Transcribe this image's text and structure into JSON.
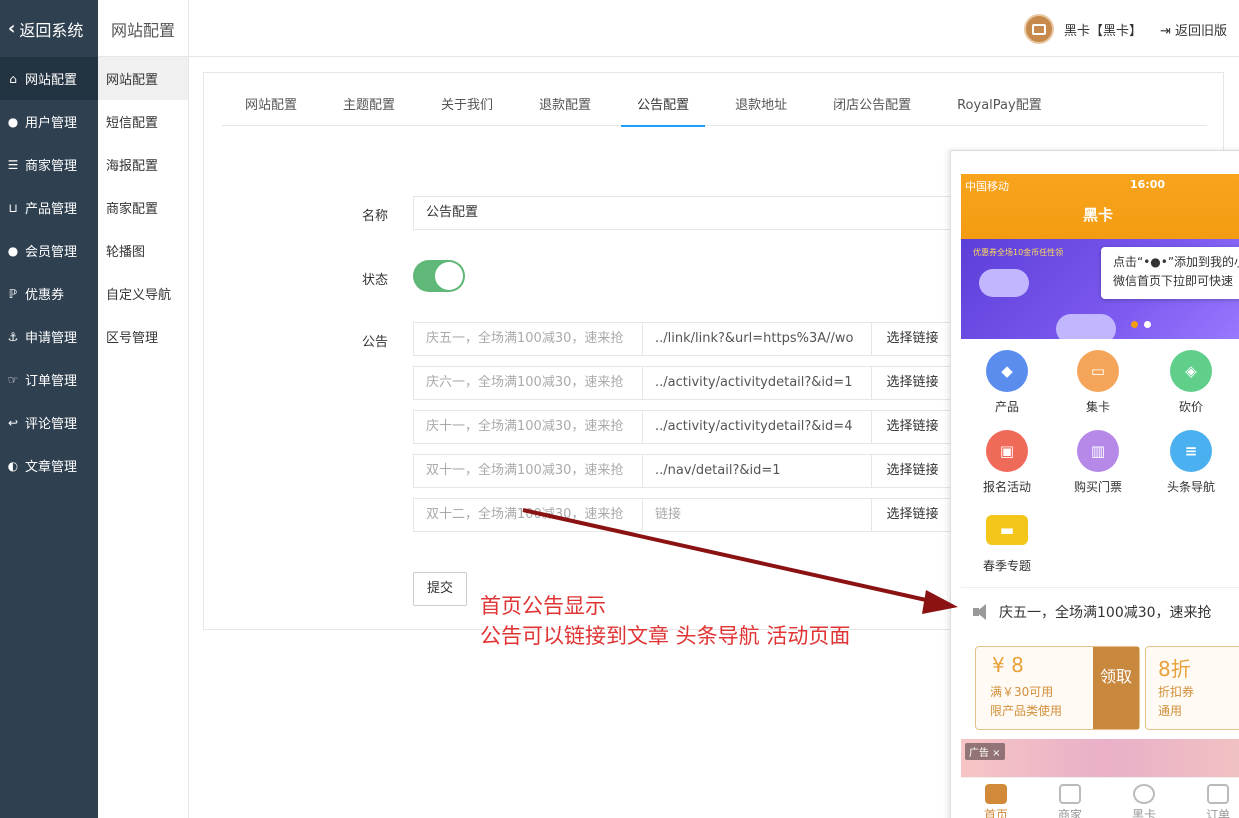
{
  "header": {
    "back_label": "返回系统",
    "section_title": "网站配置",
    "user_name": "黑卡【黑卡】",
    "old_version_label": "返回旧版"
  },
  "sidebar": {
    "items": [
      {
        "label": "网站配置",
        "icon": "home-icon"
      },
      {
        "label": "用户管理",
        "icon": "user-icon"
      },
      {
        "label": "商家管理",
        "icon": "server-icon"
      },
      {
        "label": "产品管理",
        "icon": "cart-icon"
      },
      {
        "label": "会员管理",
        "icon": "users-icon"
      },
      {
        "label": "优惠券",
        "icon": "ticket-icon"
      },
      {
        "label": "申请管理",
        "icon": "anchor-icon"
      },
      {
        "label": "订单管理",
        "icon": "hand-icon"
      },
      {
        "label": "评论管理",
        "icon": "reply-icon"
      },
      {
        "label": "文章管理",
        "icon": "contrast-icon"
      }
    ]
  },
  "subnav": {
    "items": [
      "网站配置",
      "短信配置",
      "海报配置",
      "商家配置",
      "轮播图",
      "自定义导航",
      "区号管理"
    ]
  },
  "tabs": [
    "网站配置",
    "主题配置",
    "关于我们",
    "退款配置",
    "公告配置",
    "退款地址",
    "闭店公告配置",
    "RoyalPay配置"
  ],
  "form": {
    "name_label": "名称",
    "name_value": "公告配置",
    "status_label": "状态",
    "status_on": true,
    "announce_label": "公告",
    "rows": [
      {
        "text": "庆五一，全场满100减30，速来抢",
        "link": "../link/link?&url=https%3A//wo",
        "link_is_placeholder": false
      },
      {
        "text": "庆六一，全场满100减30，速来抢",
        "link": "../activity/activitydetail?&id=1",
        "link_is_placeholder": false
      },
      {
        "text": "庆十一，全场满100减30，速来抢",
        "link": "../activity/activitydetail?&id=4",
        "link_is_placeholder": false
      },
      {
        "text": "双十一，全场满100减30，速来抢",
        "link": "../nav/detail?&id=1",
        "link_is_placeholder": false
      },
      {
        "text": "双十二，全场满100减30，速来抢",
        "link": "链接",
        "link_is_placeholder": true
      }
    ],
    "select_link_label": "选择链接",
    "submit_label": "提交"
  },
  "annotation": {
    "line1": "首页公告显示",
    "line2": "公告可以链接到文章  头条导航  活动页面"
  },
  "phone": {
    "carrier": "中国移动",
    "time": "16:00",
    "title": "黑卡",
    "banner_text": "优惠券全场10金币任性领",
    "tip_line1": "点击“•●•”添加到我的小",
    "tip_line2": "微信首页下拉即可快速",
    "grid": [
      {
        "label": "产品",
        "icon": "diamond-icon",
        "color": "#5b8def"
      },
      {
        "label": "集卡",
        "icon": "cards-icon",
        "color": "#f5a55a"
      },
      {
        "label": "砍价",
        "icon": "tag-icon",
        "color": "#5fcf8a"
      },
      {
        "label": "报名活动",
        "icon": "gift-icon",
        "color": "#f06a5a"
      },
      {
        "label": "购买门票",
        "icon": "book-icon",
        "color": "#b689e8"
      },
      {
        "label": "头条导航",
        "icon": "news-icon",
        "color": "#4bb0ef"
      },
      {
        "label": "春季专题",
        "icon": "ticket-icon",
        "color": "#f3c619"
      }
    ],
    "ticker": "庆五一，全场满100减30，速来抢",
    "coupon1": {
      "amount": "¥ 8",
      "line1": "满￥30可用",
      "line2": "限产品类使用",
      "action": "领取"
    },
    "coupon2": {
      "amount": "8折",
      "line1": "折扣券",
      "line2": "通用"
    },
    "ad_tag": "广告 ×",
    "tabbar": [
      "首页",
      "商家",
      "黑卡",
      "订单"
    ]
  },
  "colors": {
    "sidebar_bg": "#2f4050",
    "switch_on": "#5fb878",
    "tab_active_underline": "#1e9fff",
    "phone_brand": "#f39c12",
    "annotation_red": "#e03434"
  }
}
